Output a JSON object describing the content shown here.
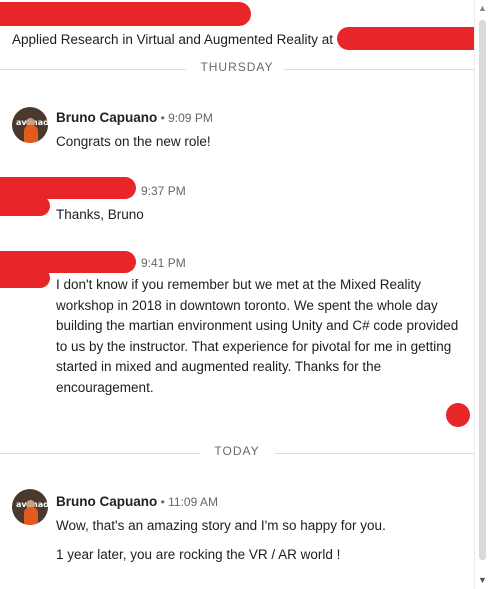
{
  "profile": {
    "headline": "Applied Research in Virtual and Augmented Reality at"
  },
  "dividers": {
    "thursday": "THURSDAY",
    "today": "TODAY"
  },
  "messages": [
    {
      "sender": "Bruno Capuano",
      "separator": " • ",
      "time": "9:09 PM",
      "lines": [
        "Congrats on the new role!"
      ]
    },
    {
      "time": "9:37 PM",
      "lines": [
        "Thanks, Bruno"
      ]
    },
    {
      "time": "9:41 PM",
      "lines": [
        "I don't know if you remember but we met at the Mixed Reality workshop in 2018 in downtown toronto. We spent the whole day building the martian environment using Unity and C# code provided to us by the instructor. That experience for pivotal for me in getting started in mixed and augmented reality. Thanks for the encouragement."
      ]
    },
    {
      "sender": "Bruno Capuano",
      "separator": " • ",
      "time": "11:09 AM",
      "lines": [
        "Wow, that's an amazing story and I'm so happy for you.",
        "1 year later, you are rocking the VR / AR world !"
      ]
    }
  ],
  "avatar": {
    "mark": "avanad"
  },
  "scrollbar": {
    "up": "▲",
    "down": "▼"
  },
  "colors": {
    "redaction": "#e8262a",
    "divider": "#dcdcdc"
  }
}
